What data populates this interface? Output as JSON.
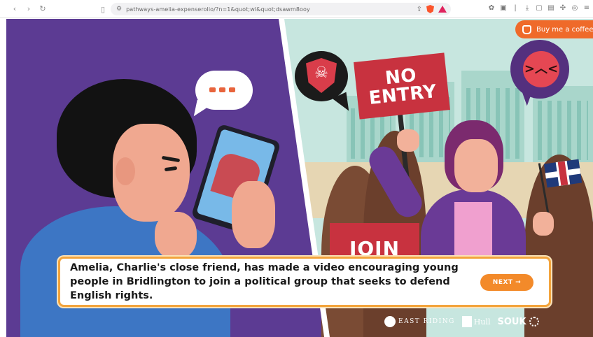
{
  "browser": {
    "url": "pathways-amelia-expenserolio/?n=1&quot;wl&quot;dsawm8ooy",
    "nav": {
      "back": "‹",
      "forward": "›",
      "reload": "↻"
    }
  },
  "support": {
    "label": "Buy me a coffee"
  },
  "scene": {
    "bubble_text": "...",
    "no_entry_line1": "NO",
    "no_entry_line2": "ENTRY",
    "join_label": "JOIN"
  },
  "caption": {
    "text": "Amelia, Charlie's close friend, has made a video encouraging young people in Bridlington to join a political group that seeks to defend English rights.",
    "next_label": "NEXT →"
  },
  "footer": {
    "east_riding": "EAST RIDING",
    "hull": "Hull",
    "souk": "SOUK"
  },
  "colors": {
    "left_bg": "#5c3b93",
    "right_bg": "#c7e6df",
    "accent_orange": "#f38a2a",
    "sign_red": "#c8323f"
  }
}
